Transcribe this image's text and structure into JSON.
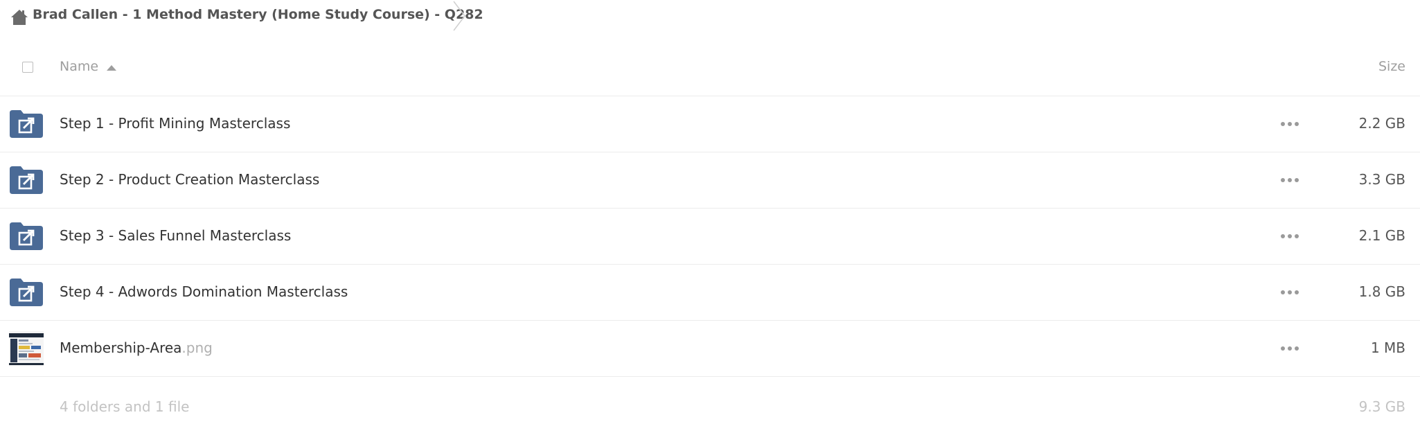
{
  "breadcrumb": {
    "home_icon": "home-icon",
    "title": "Brad Callen - 1 Method Mastery (Home Study Course) - Q282"
  },
  "table": {
    "header": {
      "name_label": "Name",
      "size_label": "Size",
      "sort_icon": "sort-ascending-icon"
    },
    "rows": [
      {
        "type": "shared-folder",
        "name": "Step 1 - Profit Mining Masterclass",
        "ext": "",
        "size": "2.2 GB"
      },
      {
        "type": "shared-folder",
        "name": "Step 2 - Product Creation Masterclass",
        "ext": "",
        "size": "3.3 GB"
      },
      {
        "type": "shared-folder",
        "name": "Step 3 - Sales Funnel Masterclass",
        "ext": "",
        "size": "2.1 GB"
      },
      {
        "type": "shared-folder",
        "name": "Step 4 - Adwords Domination Masterclass",
        "ext": "",
        "size": "1.8 GB"
      },
      {
        "type": "image-file",
        "name": "Membership-Area",
        "ext": ".png",
        "size": "1 MB"
      }
    ],
    "summary": {
      "count_text": "4 folders and 1 file",
      "total_size": "9.3 GB"
    }
  },
  "colors": {
    "folder_icon": "#4a6a96",
    "text_primary": "#333333",
    "text_muted": "#9e9e9e",
    "divider": "#ececec"
  }
}
